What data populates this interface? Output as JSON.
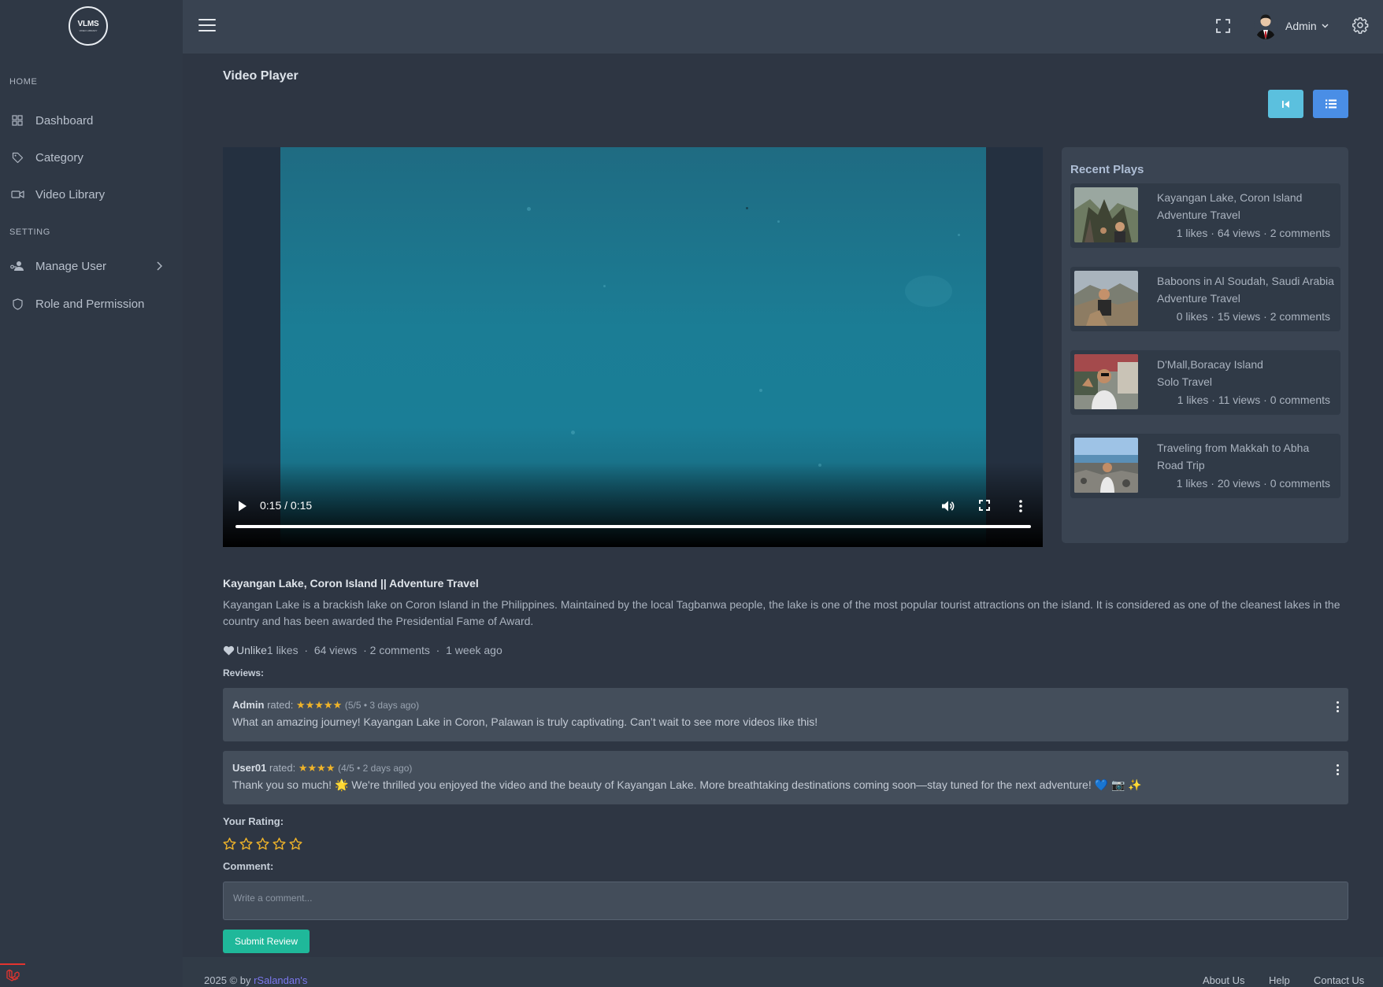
{
  "logo": {
    "text": "VLMS",
    "subtext": "VIDEO LIBRARY"
  },
  "sidebar": {
    "sections": [
      "HOME",
      "SETTING"
    ],
    "items": [
      {
        "label": "Dashboard",
        "icon": "grid-icon"
      },
      {
        "label": "Category",
        "icon": "tag-icon"
      },
      {
        "label": "Video Library",
        "icon": "video-camera-icon"
      },
      {
        "label": "Manage User",
        "icon": "user-key-icon"
      },
      {
        "label": "Role and Permission",
        "icon": "shield-icon"
      }
    ]
  },
  "topbar": {
    "user_name": "Admin"
  },
  "page": {
    "title": "Video Player"
  },
  "player": {
    "time": "0:15 / 0:15",
    "progress_percent": 100
  },
  "recent": {
    "title": "Recent Plays",
    "items": [
      {
        "title": "Kayangan Lake, Coron Island",
        "category": "Adventure Travel",
        "likes": "1 likes",
        "views": "64 views",
        "comments": "2 comments"
      },
      {
        "title": "Baboons in Al Soudah, Saudi Arabia",
        "category": "Adventure Travel",
        "likes": "0 likes",
        "views": "15 views",
        "comments": "2 comments"
      },
      {
        "title": "D'Mall,Boracay Island",
        "category": "Solo Travel",
        "likes": "1 likes",
        "views": "11 views",
        "comments": "0 comments"
      },
      {
        "title": "Traveling from Makkah to Abha",
        "category": "Road Trip",
        "likes": "1 likes",
        "views": "20 views",
        "comments": "0 comments"
      }
    ]
  },
  "video": {
    "title": "Kayangan Lake, Coron Island || Adventure Travel",
    "description": "Kayangan Lake is a brackish lake on Coron Island in the Philippines. Maintained by the local Tagbanwa people, the lake is one of the most popular tourist attractions on the island. It is considered as one of the cleanest lakes in the country and has been awarded the Presidential Fame of Award.",
    "unlike_label": "Unlike",
    "likes": "1 likes",
    "views": "64 views",
    "comments": "2 comments",
    "age": "1 week ago"
  },
  "reviews": {
    "label": "Reviews:",
    "items": [
      {
        "user": "Admin",
        "rated": "rated:",
        "stars": "★★★★★",
        "meta": "(5/5 • 3 days ago)",
        "text": "What an amazing journey! Kayangan Lake in Coron, Palawan is truly captivating. Can’t wait to see more videos like this!"
      },
      {
        "user": "User01",
        "rated": "rated:",
        "stars": "★★★★",
        "meta": "(4/5 • 2 days ago)",
        "text": "Thank you so much! 🌟 We're thrilled you enjoyed the video and the beauty of Kayangan Lake. More breathtaking destinations coming soon—stay tuned for the next adventure! 💙 📷 ✨"
      }
    ]
  },
  "form": {
    "rating_label": "Your Rating:",
    "rating_value": 0,
    "comment_label": "Comment:",
    "comment_placeholder": "Write a comment...",
    "submit_label": "Submit Review"
  },
  "footer": {
    "copyright": "2025 © by ",
    "author": "rSalandan's",
    "links": [
      "About Us",
      "Help",
      "Contact Us"
    ]
  },
  "colors": {
    "sidebar_bg": "#2f3845",
    "topbar_bg": "#394351",
    "content_bg": "#2e3643",
    "accent_info": "#5bc0de",
    "accent_primary": "#4a8ee6",
    "submit_green": "#1fb89a",
    "star_color": "#f0b429",
    "footer_link": "#7c78f0"
  }
}
